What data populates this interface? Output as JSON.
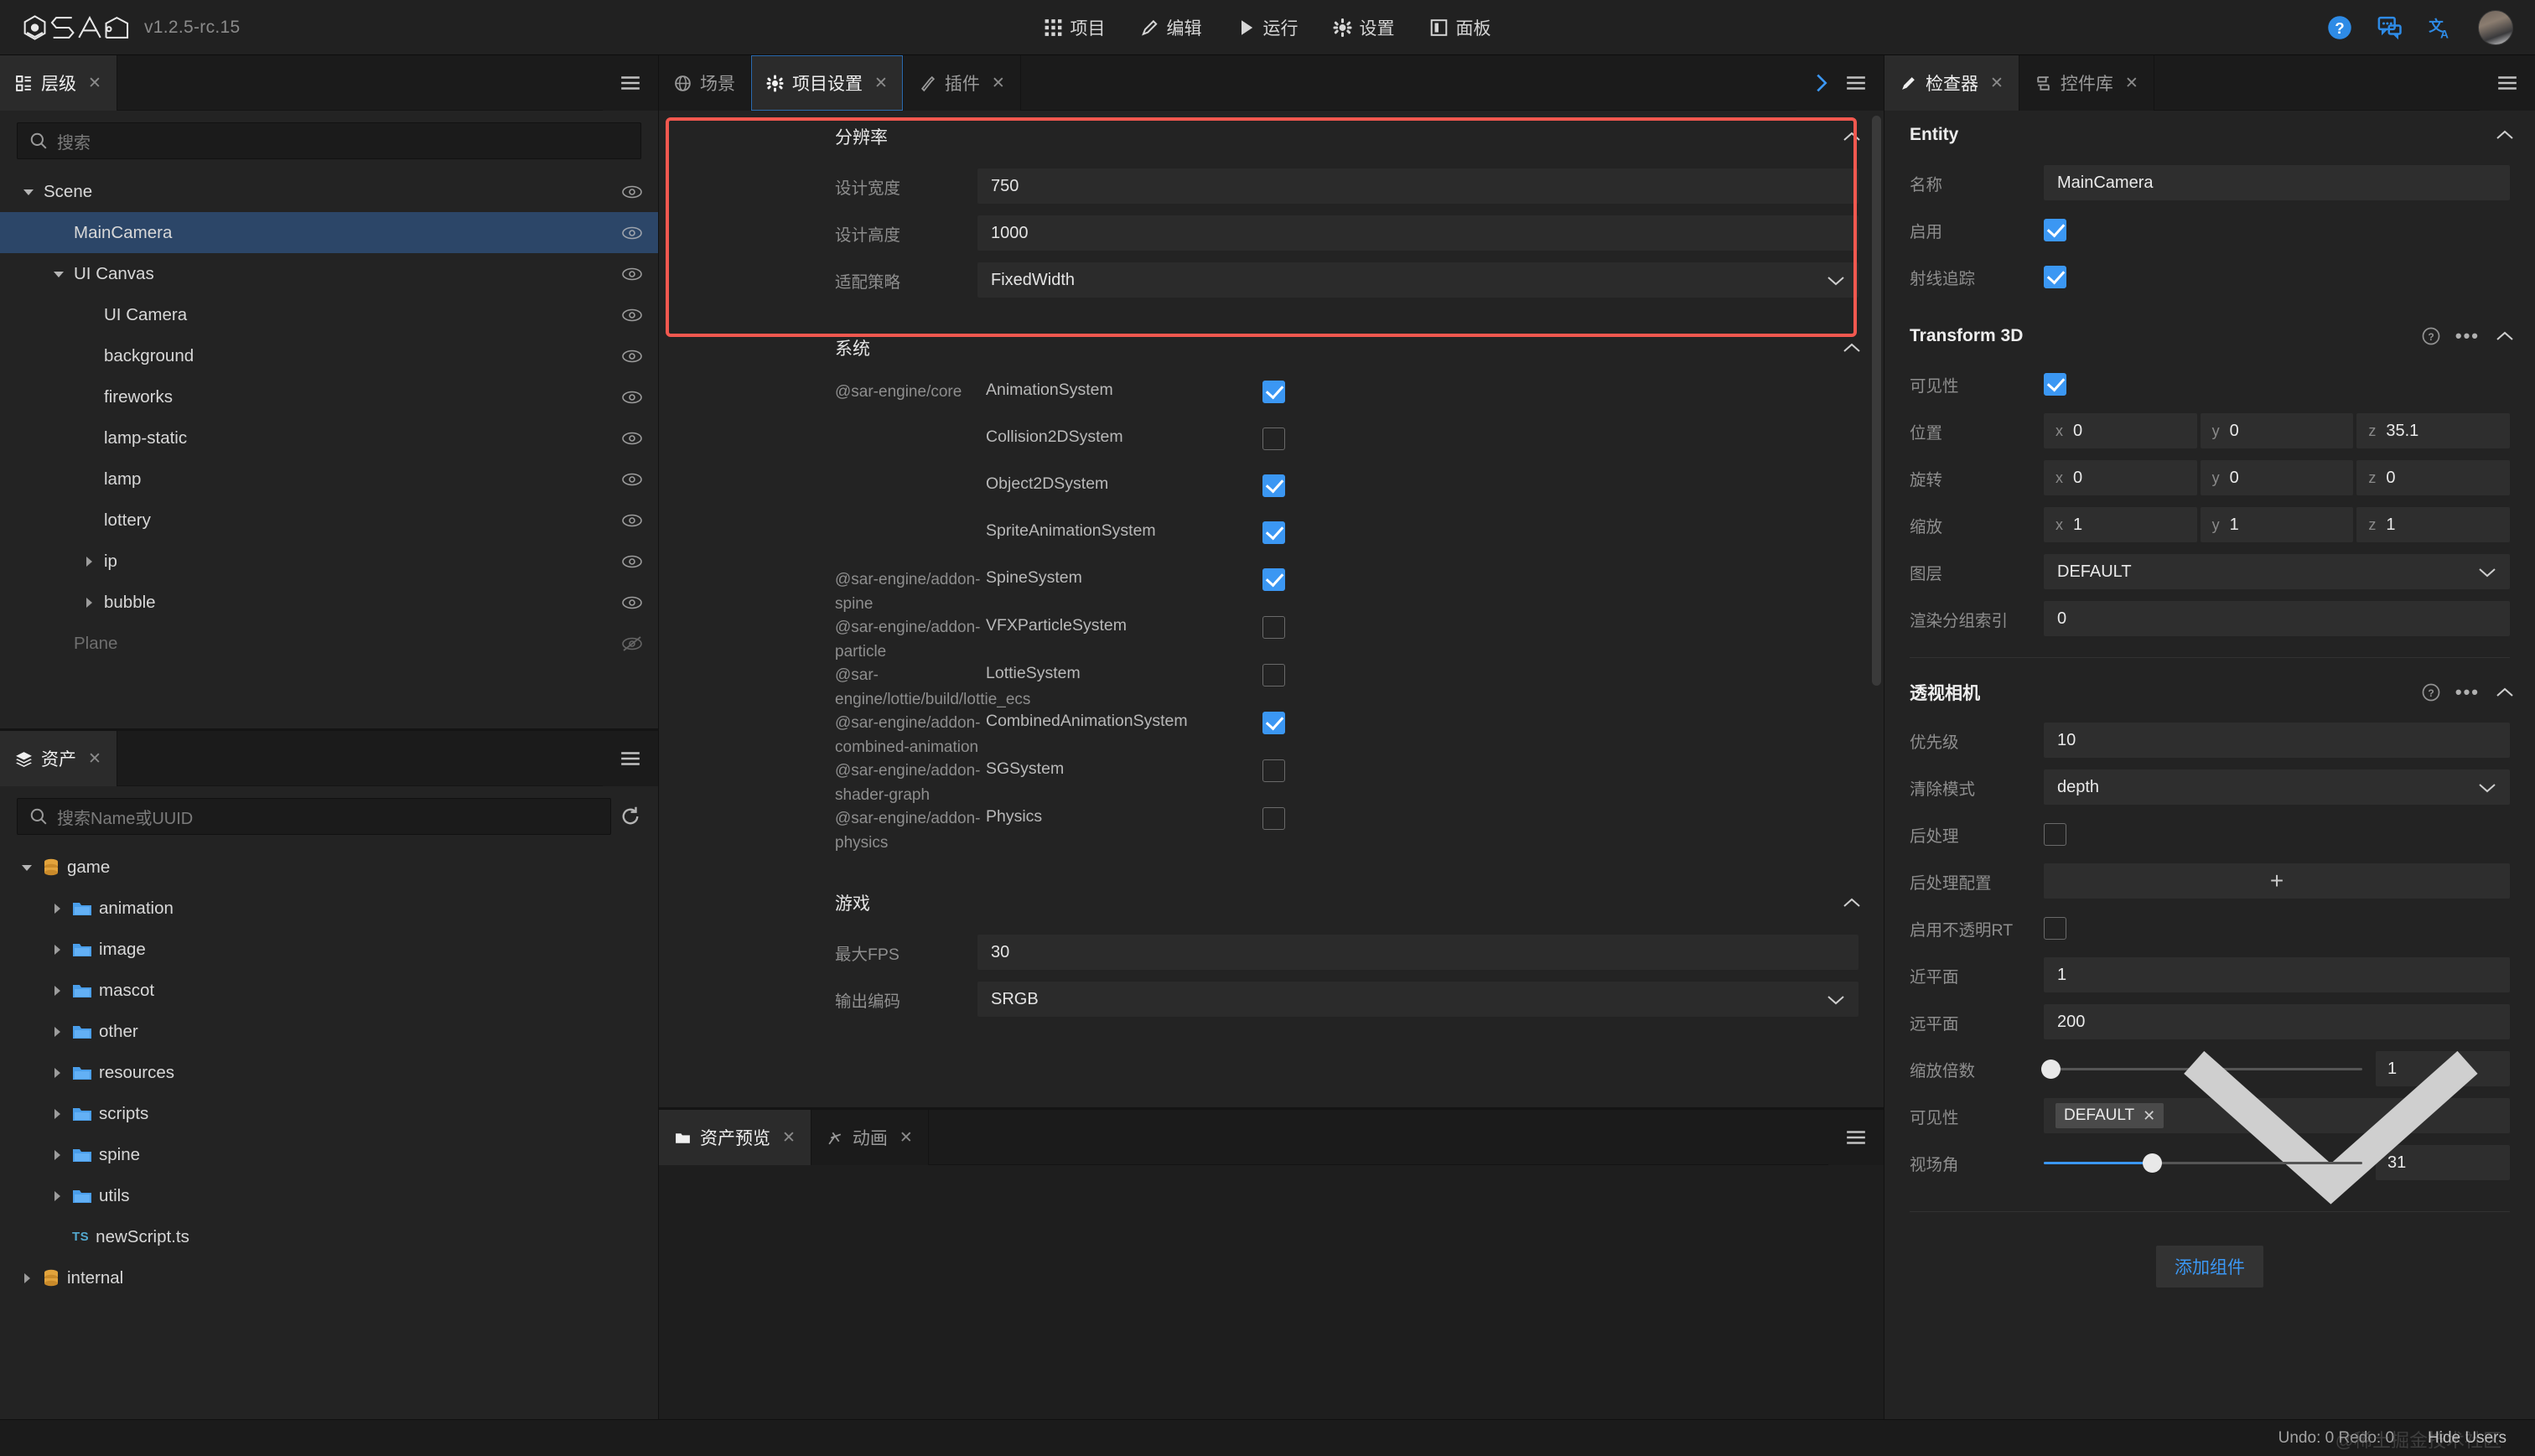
{
  "app": {
    "logo_name": "sar-engine-logo",
    "version": "v1.2.5-rc.15"
  },
  "topbar": {
    "menu": [
      {
        "label": "项目",
        "icon": "grid-icon"
      },
      {
        "label": "编辑",
        "icon": "pencil-icon"
      },
      {
        "label": "运行",
        "icon": "play-icon"
      },
      {
        "label": "设置",
        "icon": "gear-icon"
      },
      {
        "label": "面板",
        "icon": "panel-icon"
      }
    ],
    "actions": [
      {
        "name": "help-icon"
      },
      {
        "name": "chat-icon"
      },
      {
        "name": "translate-icon"
      }
    ],
    "avatar_alt": "user-avatar"
  },
  "hierarchy": {
    "tab_label": "层级",
    "tab_close": "✕",
    "search_placeholder": "搜索",
    "nodes": [
      {
        "label": "Scene",
        "depth": 0,
        "caret": "down",
        "visible": true,
        "selected": false,
        "dim": false
      },
      {
        "label": "MainCamera",
        "depth": 1,
        "caret": "none",
        "visible": true,
        "selected": true,
        "dim": false
      },
      {
        "label": "UI Canvas",
        "depth": 1,
        "caret": "down",
        "visible": true,
        "selected": false,
        "dim": false
      },
      {
        "label": "UI Camera",
        "depth": 2,
        "caret": "none",
        "visible": true,
        "selected": false,
        "dim": false
      },
      {
        "label": "background",
        "depth": 2,
        "caret": "none",
        "visible": true,
        "selected": false,
        "dim": false
      },
      {
        "label": "fireworks",
        "depth": 2,
        "caret": "none",
        "visible": true,
        "selected": false,
        "dim": false
      },
      {
        "label": "lamp-static",
        "depth": 2,
        "caret": "none",
        "visible": true,
        "selected": false,
        "dim": false
      },
      {
        "label": "lamp",
        "depth": 2,
        "caret": "none",
        "visible": true,
        "selected": false,
        "dim": false
      },
      {
        "label": "lottery",
        "depth": 2,
        "caret": "none",
        "visible": true,
        "selected": false,
        "dim": false
      },
      {
        "label": "ip",
        "depth": 2,
        "caret": "right",
        "visible": true,
        "selected": false,
        "dim": false
      },
      {
        "label": "bubble",
        "depth": 2,
        "caret": "right",
        "visible": true,
        "selected": false,
        "dim": false
      },
      {
        "label": "Plane",
        "depth": 1,
        "caret": "none",
        "visible": false,
        "selected": false,
        "dim": true
      }
    ]
  },
  "assets": {
    "tab_label": "资产",
    "tab_close": "✕",
    "search_placeholder": "搜索Name或UUID",
    "nodes": [
      {
        "label": "game",
        "depth": 0,
        "caret": "down",
        "kind": "db"
      },
      {
        "label": "animation",
        "depth": 1,
        "caret": "right",
        "kind": "folder"
      },
      {
        "label": "image",
        "depth": 1,
        "caret": "right",
        "kind": "folder"
      },
      {
        "label": "mascot",
        "depth": 1,
        "caret": "right",
        "kind": "folder"
      },
      {
        "label": "other",
        "depth": 1,
        "caret": "right",
        "kind": "folder"
      },
      {
        "label": "resources",
        "depth": 1,
        "caret": "right",
        "kind": "folder"
      },
      {
        "label": "scripts",
        "depth": 1,
        "caret": "right",
        "kind": "folder"
      },
      {
        "label": "spine",
        "depth": 1,
        "caret": "right",
        "kind": "folder"
      },
      {
        "label": "utils",
        "depth": 1,
        "caret": "right",
        "kind": "folder"
      },
      {
        "label": "newScript.ts",
        "depth": 1,
        "caret": "none",
        "kind": "ts"
      },
      {
        "label": "internal",
        "depth": 0,
        "caret": "right",
        "kind": "db"
      }
    ]
  },
  "center": {
    "tabs": [
      {
        "label": "场景",
        "icon": "scene-icon",
        "active": false,
        "closable": false
      },
      {
        "label": "项目设置",
        "icon": "gear-icon",
        "active": true,
        "closable": true
      },
      {
        "label": "插件",
        "icon": "plugin-icon",
        "active": false,
        "closable": true
      }
    ],
    "expand_icon": "chevron-right-icon",
    "menu_icon": "hamburger-icon",
    "highlight_color": "#f2584f",
    "sections": {
      "resolution": {
        "title": "分辨率",
        "rows": [
          {
            "label": "设计宽度",
            "value": "750",
            "type": "text"
          },
          {
            "label": "设计高度",
            "value": "1000",
            "type": "text"
          },
          {
            "label": "适配策略",
            "value": "FixedWidth",
            "type": "select"
          }
        ]
      },
      "systems": {
        "title": "系统",
        "rows": [
          {
            "package": "@sar-engine/core",
            "system": "AnimationSystem",
            "checked": true
          },
          {
            "package": "",
            "system": "Collision2DSystem",
            "checked": false
          },
          {
            "package": "",
            "system": "Object2DSystem",
            "checked": true
          },
          {
            "package": "",
            "system": "SpriteAnimationSystem",
            "checked": true
          },
          {
            "package": "@sar-engine/addon-spine",
            "system": "SpineSystem",
            "checked": true
          },
          {
            "package": "@sar-engine/addon-particle",
            "system": "VFXParticleSystem",
            "checked": false
          },
          {
            "package": "@sar-engine/lottie/build/lottie_ecs",
            "system": "LottieSystem",
            "checked": false
          },
          {
            "package": "@sar-engine/addon-combined-animation",
            "system": "CombinedAnimationSystem",
            "checked": true
          },
          {
            "package": "@sar-engine/addon-shader-graph",
            "system": "SGSystem",
            "checked": false
          },
          {
            "package": "@sar-engine/addon-physics",
            "system": "Physics",
            "checked": false
          }
        ]
      },
      "game": {
        "title": "游戏",
        "rows": [
          {
            "label": "最大FPS",
            "value": "30",
            "type": "text"
          },
          {
            "label": "输出编码",
            "value": "SRGB",
            "type": "select"
          }
        ]
      }
    }
  },
  "bottom_dock": {
    "tabs": [
      {
        "label": "资产预览",
        "icon": "asset-preview-icon",
        "active": true
      },
      {
        "label": "动画",
        "icon": "animation-icon",
        "active": false
      }
    ],
    "menu_icon": "hamburger-icon"
  },
  "inspector": {
    "tabs": [
      {
        "label": "检查器",
        "icon": "pencil-icon",
        "active": true
      },
      {
        "label": "控件库",
        "icon": "library-icon",
        "active": false
      }
    ],
    "entity": {
      "title": "Entity",
      "name_label": "名称",
      "name_value": "MainCamera",
      "enable_label": "启用",
      "enable_checked": true,
      "raycast_label": "射线追踪",
      "raycast_checked": true
    },
    "transform": {
      "title": "Transform 3D",
      "visible_label": "可见性",
      "visible_checked": true,
      "position_label": "位置",
      "position": {
        "x": "0",
        "y": "0",
        "z": "35.1"
      },
      "rotation_label": "旋转",
      "rotation": {
        "x": "0",
        "y": "0",
        "z": "0"
      },
      "scale_label": "缩放",
      "scale": {
        "x": "1",
        "y": "1",
        "z": "1"
      },
      "layer_label": "图层",
      "layer_value": "DEFAULT",
      "render_group_label": "渲染分组索引",
      "render_group_value": "0"
    },
    "camera": {
      "title": "透视相机",
      "priority_label": "优先级",
      "priority_value": "10",
      "clear_label": "清除模式",
      "clear_value": "depth",
      "post_label": "后处理",
      "post_checked": false,
      "post_config_label": "后处理配置",
      "post_config_add": "+",
      "opaque_rt_label": "启用不透明RT",
      "opaque_rt_checked": false,
      "near_label": "近平面",
      "near_value": "1",
      "far_label": "远平面",
      "far_value": "200",
      "zoom_label": "缩放倍数",
      "zoom_value": "1",
      "zoom_percent": 2,
      "visibility_label": "可见性",
      "visibility_chip": "DEFAULT",
      "visibility_chip_x": "✕",
      "fov_label": "视场角",
      "fov_value": "31",
      "fov_percent": 34
    },
    "add_component_label": "添加组件"
  },
  "statusbar": {
    "undo_redo": "Undo: 0 Redo: 0",
    "hide_users": "Hide Users",
    "watermark": "@稀土掘金技术社区"
  },
  "colors": {
    "accent_blue": "#3b97f3",
    "selection_blue": "#2c4668",
    "highlight_red": "#f2584f",
    "panel_bg": "#232323",
    "tab_bg": "#1b1b1b"
  }
}
